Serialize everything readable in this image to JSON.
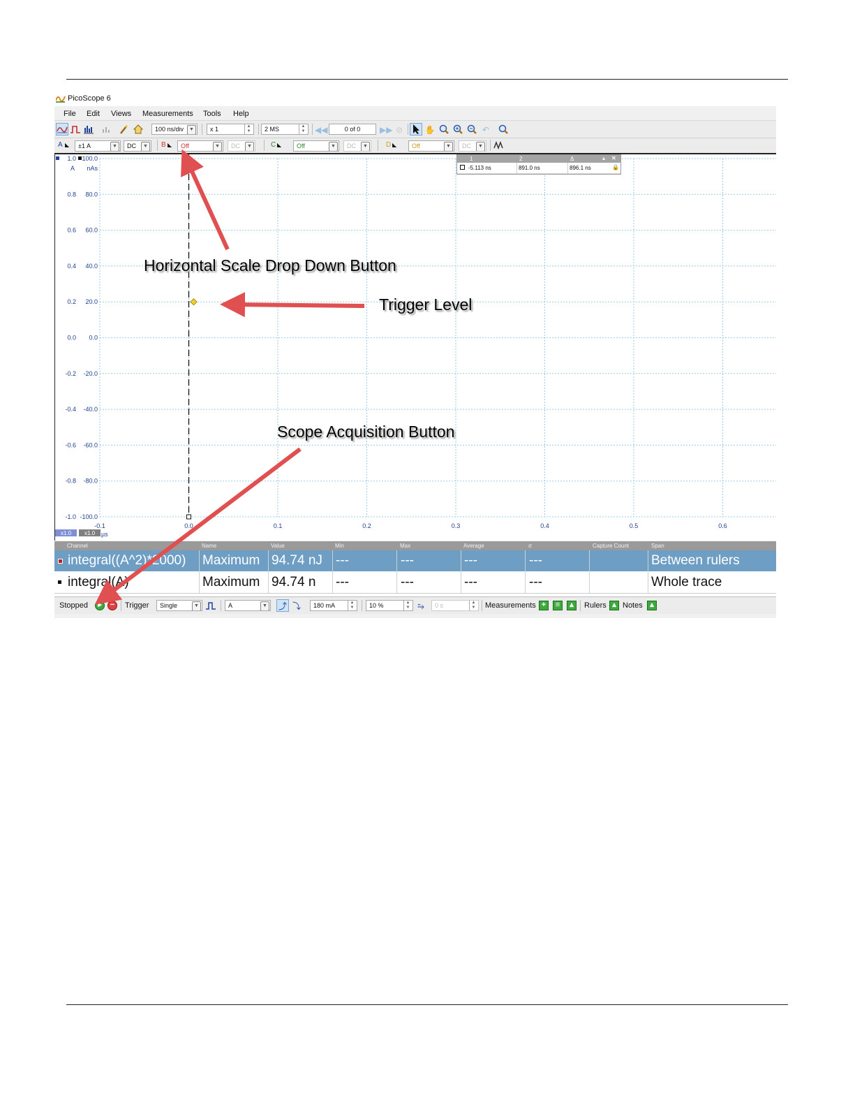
{
  "app": {
    "title": "PicoScope 6"
  },
  "menu": [
    "File",
    "Edit",
    "Views",
    "Measurements",
    "Tools",
    "Help"
  ],
  "toolbar": {
    "timebase": "100 ns/div",
    "zoom": "x 1",
    "samples": "2 MS",
    "buffer": "0 of 0"
  },
  "channels": {
    "a": {
      "label": "A",
      "range": "±1 A",
      "coupling": "DC"
    },
    "b": {
      "label": "B",
      "range": "Off",
      "coupling": "DC"
    },
    "c": {
      "label": "C",
      "range": "Off",
      "coupling": "DC"
    },
    "d": {
      "label": "D",
      "range": "Off",
      "coupling": "DC"
    }
  },
  "ruler_panel": {
    "col1": "1",
    "col2": "2",
    "col3": "Δ",
    "v1": "-5.113 ns",
    "v2": "891.0 ns",
    "v3": "896.1 ns"
  },
  "chart_data": {
    "type": "line",
    "y_left_unit": "A",
    "y_right_unit": "nAs",
    "x_unit": "µs",
    "y_left_ticks": [
      "1.0",
      "0.8",
      "0.6",
      "0.4",
      "0.2",
      "0.0",
      "-0.2",
      "-0.4",
      "-0.6",
      "-0.8",
      "-1.0"
    ],
    "y_right_ticks": [
      "100.0",
      "80.0",
      "60.0",
      "40.0",
      "20.0",
      "0.0",
      "-20.0",
      "-40.0",
      "-60.0",
      "-80.0",
      "-100.0"
    ],
    "x_ticks": [
      "-0.1",
      "0.0",
      "0.1",
      "0.2",
      "0.3",
      "0.4",
      "0.5",
      "0.6"
    ],
    "y_range": [
      -1.0,
      1.0
    ],
    "x_range": [
      -0.1,
      0.66
    ],
    "trigger_time_us": 0.0,
    "trigger_level_A": 0.2,
    "zoom_labels": [
      "x1.0",
      "x1.0"
    ],
    "grid": true
  },
  "measurements": {
    "headers": [
      "Channel",
      "Name",
      "Value",
      "Min",
      "Max",
      "Average",
      "σ",
      "Capture Count",
      "Span"
    ],
    "rows": [
      {
        "channel": "integral((A^2)*2000)",
        "name": "Maximum",
        "value": "94.74 nJ",
        "min": "---",
        "max": "---",
        "average": "---",
        "sigma": "---",
        "count": "",
        "span": "Between rulers"
      },
      {
        "channel": "integral(A)",
        "name": "Maximum",
        "value": "94.74 n",
        "min": "---",
        "max": "---",
        "average": "---",
        "sigma": "---",
        "count": "",
        "span": "Whole trace"
      }
    ]
  },
  "status": {
    "state": "Stopped",
    "trigger_label": "Trigger",
    "trigger_mode": "Single",
    "trigger_source": "A",
    "threshold": "180 mA",
    "pre_trigger": "10 %",
    "delay": "0 s",
    "measurements_label": "Measurements",
    "rulers_label": "Rulers",
    "notes_label": "Notes"
  },
  "annotations": {
    "horizontal_scale": "Horizontal Scale Drop Down Button",
    "trigger_level": "Trigger Level",
    "acquisition": "Scope Acquisition Button"
  },
  "colors": {
    "grid": "#9fc9e4",
    "axis_text": "#1f3f8f",
    "selected_row": "#6f9ec4",
    "arrow": "#e05050",
    "trigger_marker": "#f2d230"
  }
}
